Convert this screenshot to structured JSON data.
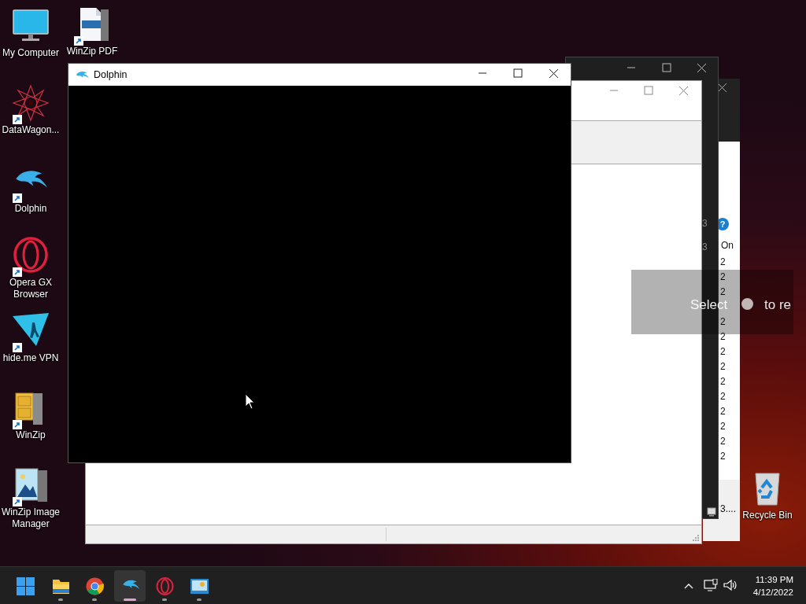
{
  "desktop_icons": [
    {
      "label": "My Computer",
      "kind": "computer",
      "shortcut": false
    },
    {
      "label": "WinZip PDF",
      "kind": "pdf",
      "shortcut": true
    },
    {
      "label": "DataWagon...",
      "kind": "star",
      "shortcut": true
    },
    {
      "label": "Dolphin",
      "kind": "dolphin",
      "shortcut": true
    },
    {
      "label": "Opera GX Browser",
      "kind": "ring",
      "shortcut": true
    },
    {
      "label": "hide.me VPN",
      "kind": "vpn",
      "shortcut": true
    },
    {
      "label": "WinZip",
      "kind": "zip",
      "shortcut": true
    },
    {
      "label": "WinZip Image Manager",
      "kind": "image",
      "shortcut": true
    },
    {
      "label": "Recycle Bin",
      "kind": "bin",
      "shortcut": false
    }
  ],
  "dark_window": {
    "values": [
      "3",
      "3"
    ]
  },
  "right_window": {
    "help": "?",
    "header": "On",
    "values": [
      "2",
      "2",
      "2",
      "2",
      "2",
      "2",
      "2",
      "2",
      "2",
      "2",
      "2",
      "2",
      "2"
    ],
    "footer": "3...."
  },
  "dolphin_window": {
    "title": "Dolphin"
  },
  "caption": {
    "before": "Select",
    "after": "to re"
  },
  "taskbar": {
    "apps": [
      {
        "kind": "start",
        "running": false,
        "selected": false
      },
      {
        "kind": "folder",
        "running": true,
        "selected": false
      },
      {
        "kind": "chrome",
        "running": true,
        "selected": false
      },
      {
        "kind": "dolphin",
        "running": true,
        "selected": true
      },
      {
        "kind": "ring",
        "running": true,
        "selected": false
      },
      {
        "kind": "screen",
        "running": true,
        "selected": false
      }
    ],
    "time": "11:39 PM",
    "date": "4/12/2022"
  }
}
